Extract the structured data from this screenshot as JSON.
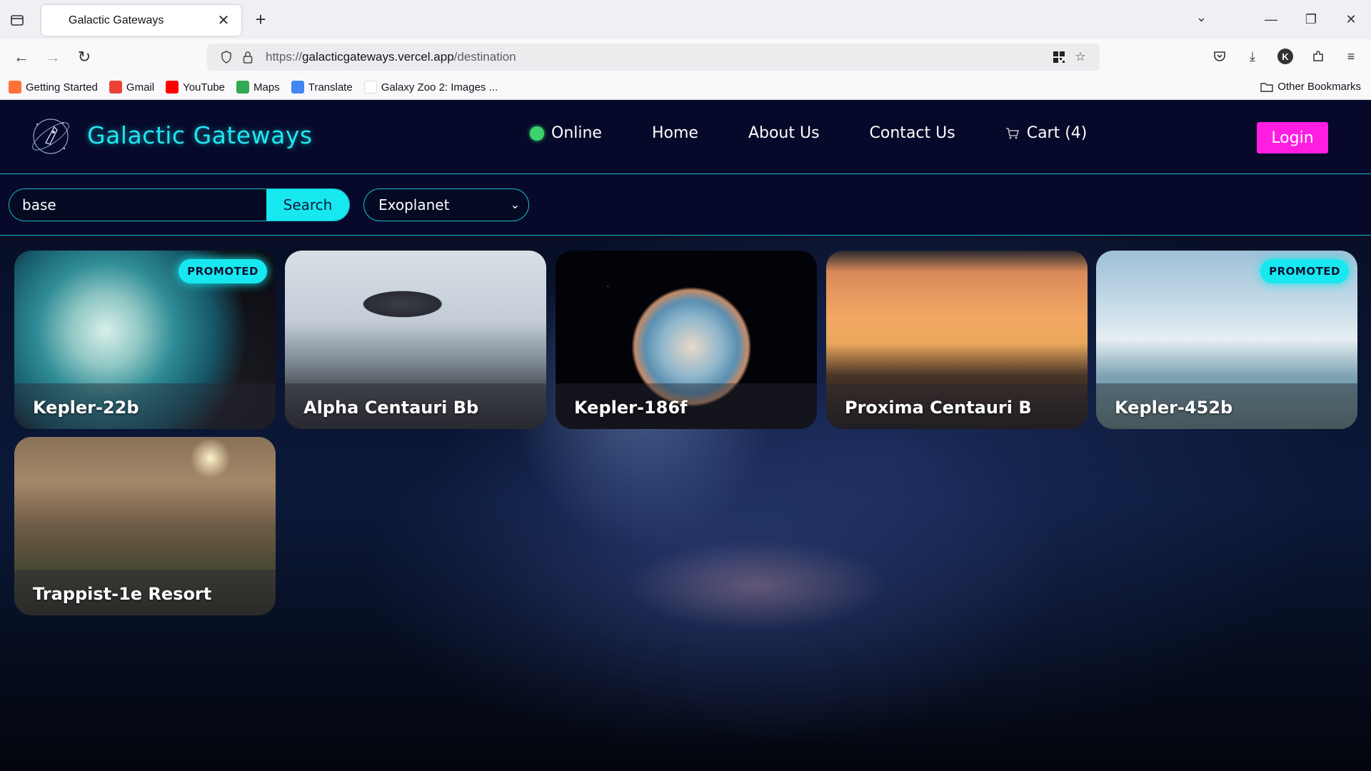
{
  "browser": {
    "tab_title": "Galactic Gateways",
    "url_prefix": "https://",
    "url_host": "galacticgateways.vercel.app",
    "url_path": "/destination",
    "bookmarks": [
      {
        "label": "Getting Started",
        "icon": "firefox-icon",
        "color": "#ff7139"
      },
      {
        "label": "Gmail",
        "icon": "gmail-icon",
        "color": "#ea4335"
      },
      {
        "label": "YouTube",
        "icon": "youtube-icon",
        "color": "#ff0000"
      },
      {
        "label": "Maps",
        "icon": "maps-icon",
        "color": "#34a853"
      },
      {
        "label": "Translate",
        "icon": "translate-icon",
        "color": "#4285f4"
      },
      {
        "label": "Galaxy Zoo 2: Images ...",
        "icon": "page-icon",
        "color": "#ffffff"
      }
    ],
    "other_bookmarks": "Other Bookmarks",
    "profile_initial": "K"
  },
  "site": {
    "brand": "Galactic Gateways",
    "nav": {
      "online": "Online",
      "home": "Home",
      "about": "About Us",
      "contact": "Contact Us",
      "cart": "Cart (4)"
    },
    "login": "Login",
    "search": {
      "value": "base",
      "button": "Search"
    },
    "type_filter": "Exoplanet",
    "accent": "#17e8ef",
    "login_color": "#ff1de1",
    "destinations": [
      {
        "name": "Kepler-22b",
        "promoted": "PROMOTED"
      },
      {
        "name": "Alpha Centauri Bb",
        "promoted": ""
      },
      {
        "name": "Kepler-186f",
        "promoted": ""
      },
      {
        "name": "Proxima Centauri B",
        "promoted": ""
      },
      {
        "name": "Kepler-452b",
        "promoted": "PROMOTED"
      },
      {
        "name": "Trappist-1e Resort",
        "promoted": ""
      }
    ]
  }
}
